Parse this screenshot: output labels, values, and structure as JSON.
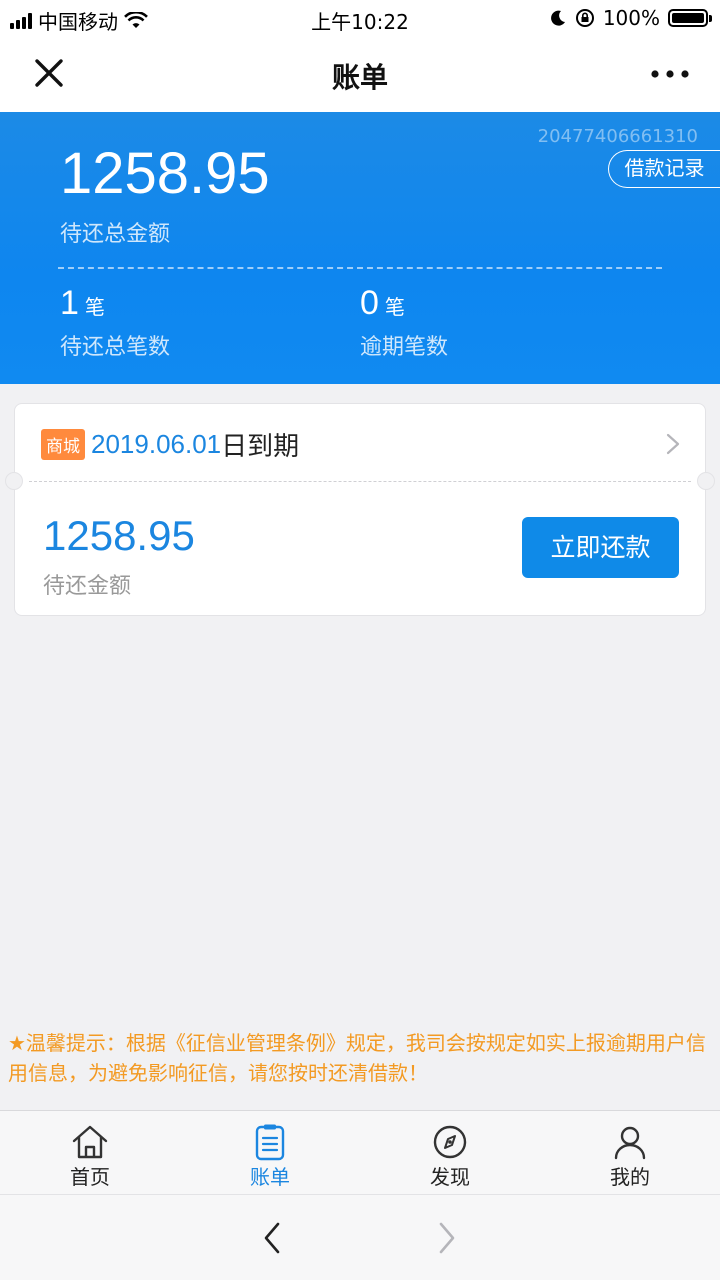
{
  "status_bar": {
    "carrier": "中国移动",
    "time": "上午10:22",
    "battery": "100%",
    "icons": [
      "signal-icon",
      "wifi-icon",
      "moon-icon",
      "rotation-lock-icon",
      "battery-icon"
    ]
  },
  "navbar": {
    "title": "账单",
    "close_icon": "close-icon",
    "more_icon": "more-icon"
  },
  "summary": {
    "account_no": "20477406661310",
    "record_button": "借款记录",
    "total_amount": "1258.95",
    "total_label": "待还总金额",
    "pending_count": "1",
    "pending_unit": "笔",
    "pending_label": "待还总笔数",
    "overdue_count": "0",
    "overdue_unit": "笔",
    "overdue_label": "逾期笔数"
  },
  "bill": {
    "tag": "商城",
    "date": "2019.06.01",
    "due_text": "日到期",
    "amount": "1258.95",
    "amount_label": "待还金额",
    "pay_button": "立即还款"
  },
  "notice": "★温馨提示：根据《征信业管理条例》规定，我司会按规定如实上报逾期用户信用信息，为避免影响征信，请您按时还清借款！",
  "tabs": [
    {
      "label": "首页",
      "icon": "home-icon",
      "active": false
    },
    {
      "label": "账单",
      "icon": "bill-icon",
      "active": true
    },
    {
      "label": "发现",
      "icon": "compass-icon",
      "active": false
    },
    {
      "label": "我的",
      "icon": "user-icon",
      "active": false,
      "badge": true
    }
  ],
  "colors": {
    "primary": "#0f8ae8",
    "tag": "#ff8a3d",
    "notice": "#f39a23",
    "badge": "#f03a3a"
  }
}
